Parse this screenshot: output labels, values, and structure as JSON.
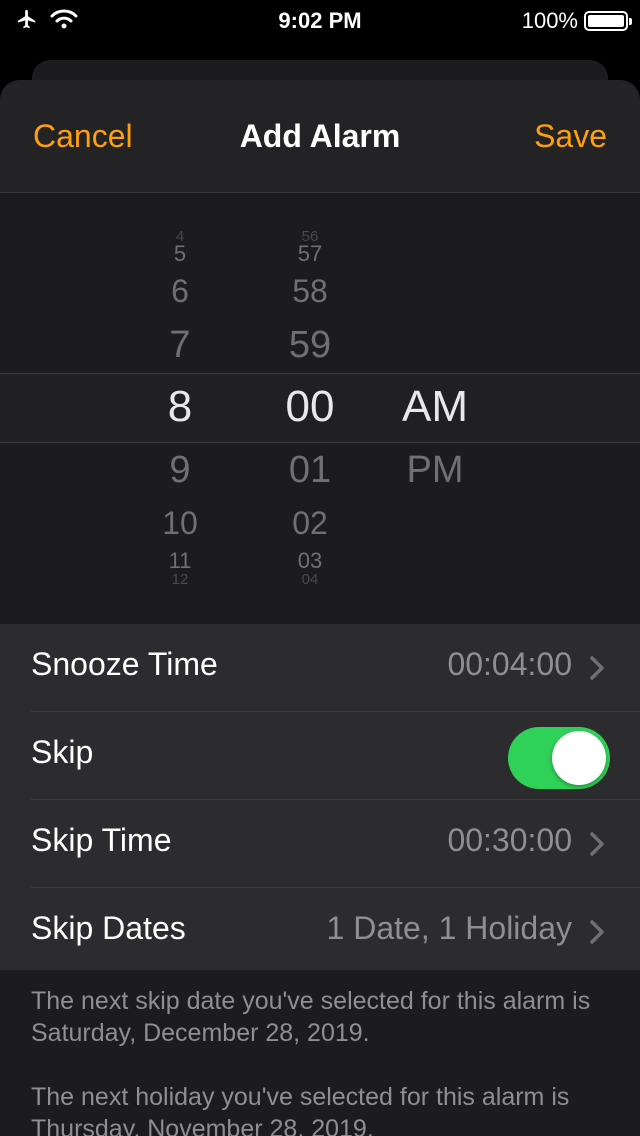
{
  "status": {
    "time": "9:02 PM",
    "battery": "100%"
  },
  "nav": {
    "cancel": "Cancel",
    "title": "Add Alarm",
    "save": "Save"
  },
  "picker": {
    "hour_above": [
      "4",
      "5",
      "6",
      "7"
    ],
    "hour_selected": "8",
    "hour_below": [
      "9",
      "10",
      "11",
      "12"
    ],
    "minute_above": [
      "56",
      "57",
      "58",
      "59"
    ],
    "minute_selected": "00",
    "minute_below": [
      "01",
      "02",
      "03",
      "04"
    ],
    "period_selected": "AM",
    "period_other": "PM"
  },
  "settings": {
    "snooze_label": "Snooze Time",
    "snooze_value": "00:04:00",
    "skip_label": "Skip",
    "skip_enabled": true,
    "skip_time_label": "Skip Time",
    "skip_time_value": "00:30:00",
    "skip_dates_label": "Skip Dates",
    "skip_dates_value": "1 Date, 1 Holiday"
  },
  "footer": {
    "note1": "The next skip date you've selected for this alarm is Saturday, December 28, 2019.",
    "note2": "The next holiday you've selected for this alarm is Thursday, November 28, 2019."
  },
  "colors": {
    "accent": "#ff9f0a",
    "toggle_on": "#30d158"
  }
}
